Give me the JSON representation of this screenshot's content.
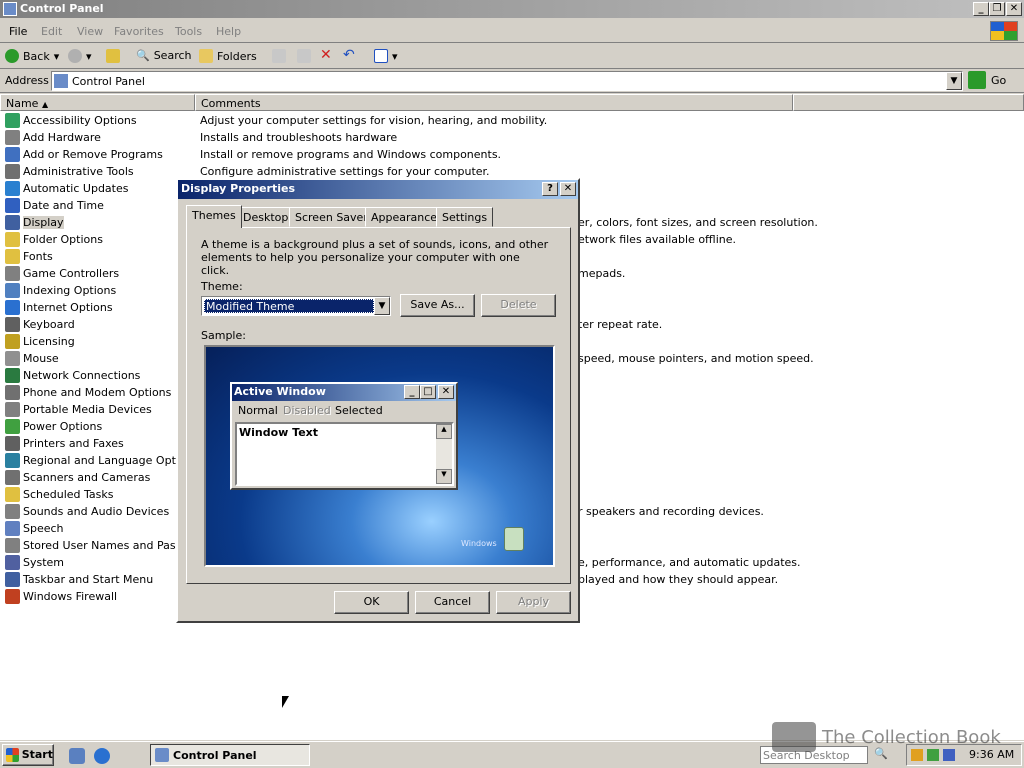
{
  "window": {
    "title": "Control Panel"
  },
  "menu": [
    "File",
    "Edit",
    "View",
    "Favorites",
    "Tools",
    "Help"
  ],
  "toolbar": {
    "back": "Back",
    "search": "Search",
    "folders": "Folders"
  },
  "address": {
    "label": "Address",
    "value": "Control Panel",
    "go": "Go"
  },
  "columns": {
    "name": "Name",
    "comments": "Comments"
  },
  "items": [
    {
      "name": "Accessibility Options",
      "icon": "accessibility-icon"
    },
    {
      "name": "Add Hardware",
      "icon": "hardware-icon"
    },
    {
      "name": "Add or Remove Programs",
      "icon": "programs-icon"
    },
    {
      "name": "Administrative Tools",
      "icon": "admin-tools-icon"
    },
    {
      "name": "Automatic Updates",
      "icon": "updates-icon"
    },
    {
      "name": "Date and Time",
      "icon": "clock-icon"
    },
    {
      "name": "Display",
      "icon": "display-icon"
    },
    {
      "name": "Folder Options",
      "icon": "folder-icon"
    },
    {
      "name": "Fonts",
      "icon": "fonts-icon"
    },
    {
      "name": "Game Controllers",
      "icon": "gamepad-icon"
    },
    {
      "name": "Indexing Options",
      "icon": "indexing-icon"
    },
    {
      "name": "Internet Options",
      "icon": "internet-icon"
    },
    {
      "name": "Keyboard",
      "icon": "keyboard-icon"
    },
    {
      "name": "Licensing",
      "icon": "licensing-icon"
    },
    {
      "name": "Mouse",
      "icon": "mouse-icon"
    },
    {
      "name": "Network Connections",
      "icon": "network-icon"
    },
    {
      "name": "Phone and Modem Options",
      "icon": "phone-icon"
    },
    {
      "name": "Portable Media Devices",
      "icon": "media-device-icon"
    },
    {
      "name": "Power Options",
      "icon": "power-icon"
    },
    {
      "name": "Printers and Faxes",
      "icon": "printer-icon"
    },
    {
      "name": "Regional and Language Options",
      "icon": "globe-icon"
    },
    {
      "name": "Scanners and Cameras",
      "icon": "camera-icon"
    },
    {
      "name": "Scheduled Tasks",
      "icon": "tasks-icon"
    },
    {
      "name": "Sounds and Audio Devices",
      "icon": "sound-icon"
    },
    {
      "name": "Speech",
      "icon": "speech-icon"
    },
    {
      "name": "Stored User Names and Passwo",
      "icon": "key-icon"
    },
    {
      "name": "System",
      "icon": "system-icon"
    },
    {
      "name": "Taskbar and Start Menu",
      "icon": "taskbar-icon"
    },
    {
      "name": "Windows Firewall",
      "icon": "firewall-icon"
    }
  ],
  "comments": [
    "Adjust your computer settings for vision, hearing, and mobility.",
    "Installs and troubleshoots hardware",
    "Install or remove programs and Windows components.",
    "Configure administrative settings for your computer.",
    "er, colors, font sizes, and screen resolution.",
    "etwork files available offline.",
    "mepads.",
    "ter repeat rate.",
    "speed, mouse pointers, and motion speed.",
    "r speakers and recording devices.",
    "e, performance, and automatic updates.",
    "played and how they should appear."
  ],
  "dialog": {
    "title": "Display Properties",
    "tabs": [
      "Themes",
      "Desktop",
      "Screen Saver",
      "Appearance",
      "Settings"
    ],
    "description": "A theme is a background plus a set of sounds, icons, and other elements to help you personalize your computer with one click.",
    "theme_label": "Theme:",
    "theme_value": "Modified Theme",
    "save_as": "Save As...",
    "delete": "Delete",
    "sample_label": "Sample:",
    "preview": {
      "title": "Active Window",
      "menu_normal": "Normal",
      "menu_disabled": "Disabled",
      "menu_selected": "Selected",
      "text": "Window Text",
      "wallpaper_text": "Windows"
    },
    "ok": "OK",
    "cancel": "Cancel",
    "apply": "Apply"
  },
  "taskbar": {
    "start": "Start",
    "task": "Control Panel",
    "search_placeholder": "Search Desktop",
    "clock": "9:36 AM"
  },
  "watermark": "The Collection Book"
}
